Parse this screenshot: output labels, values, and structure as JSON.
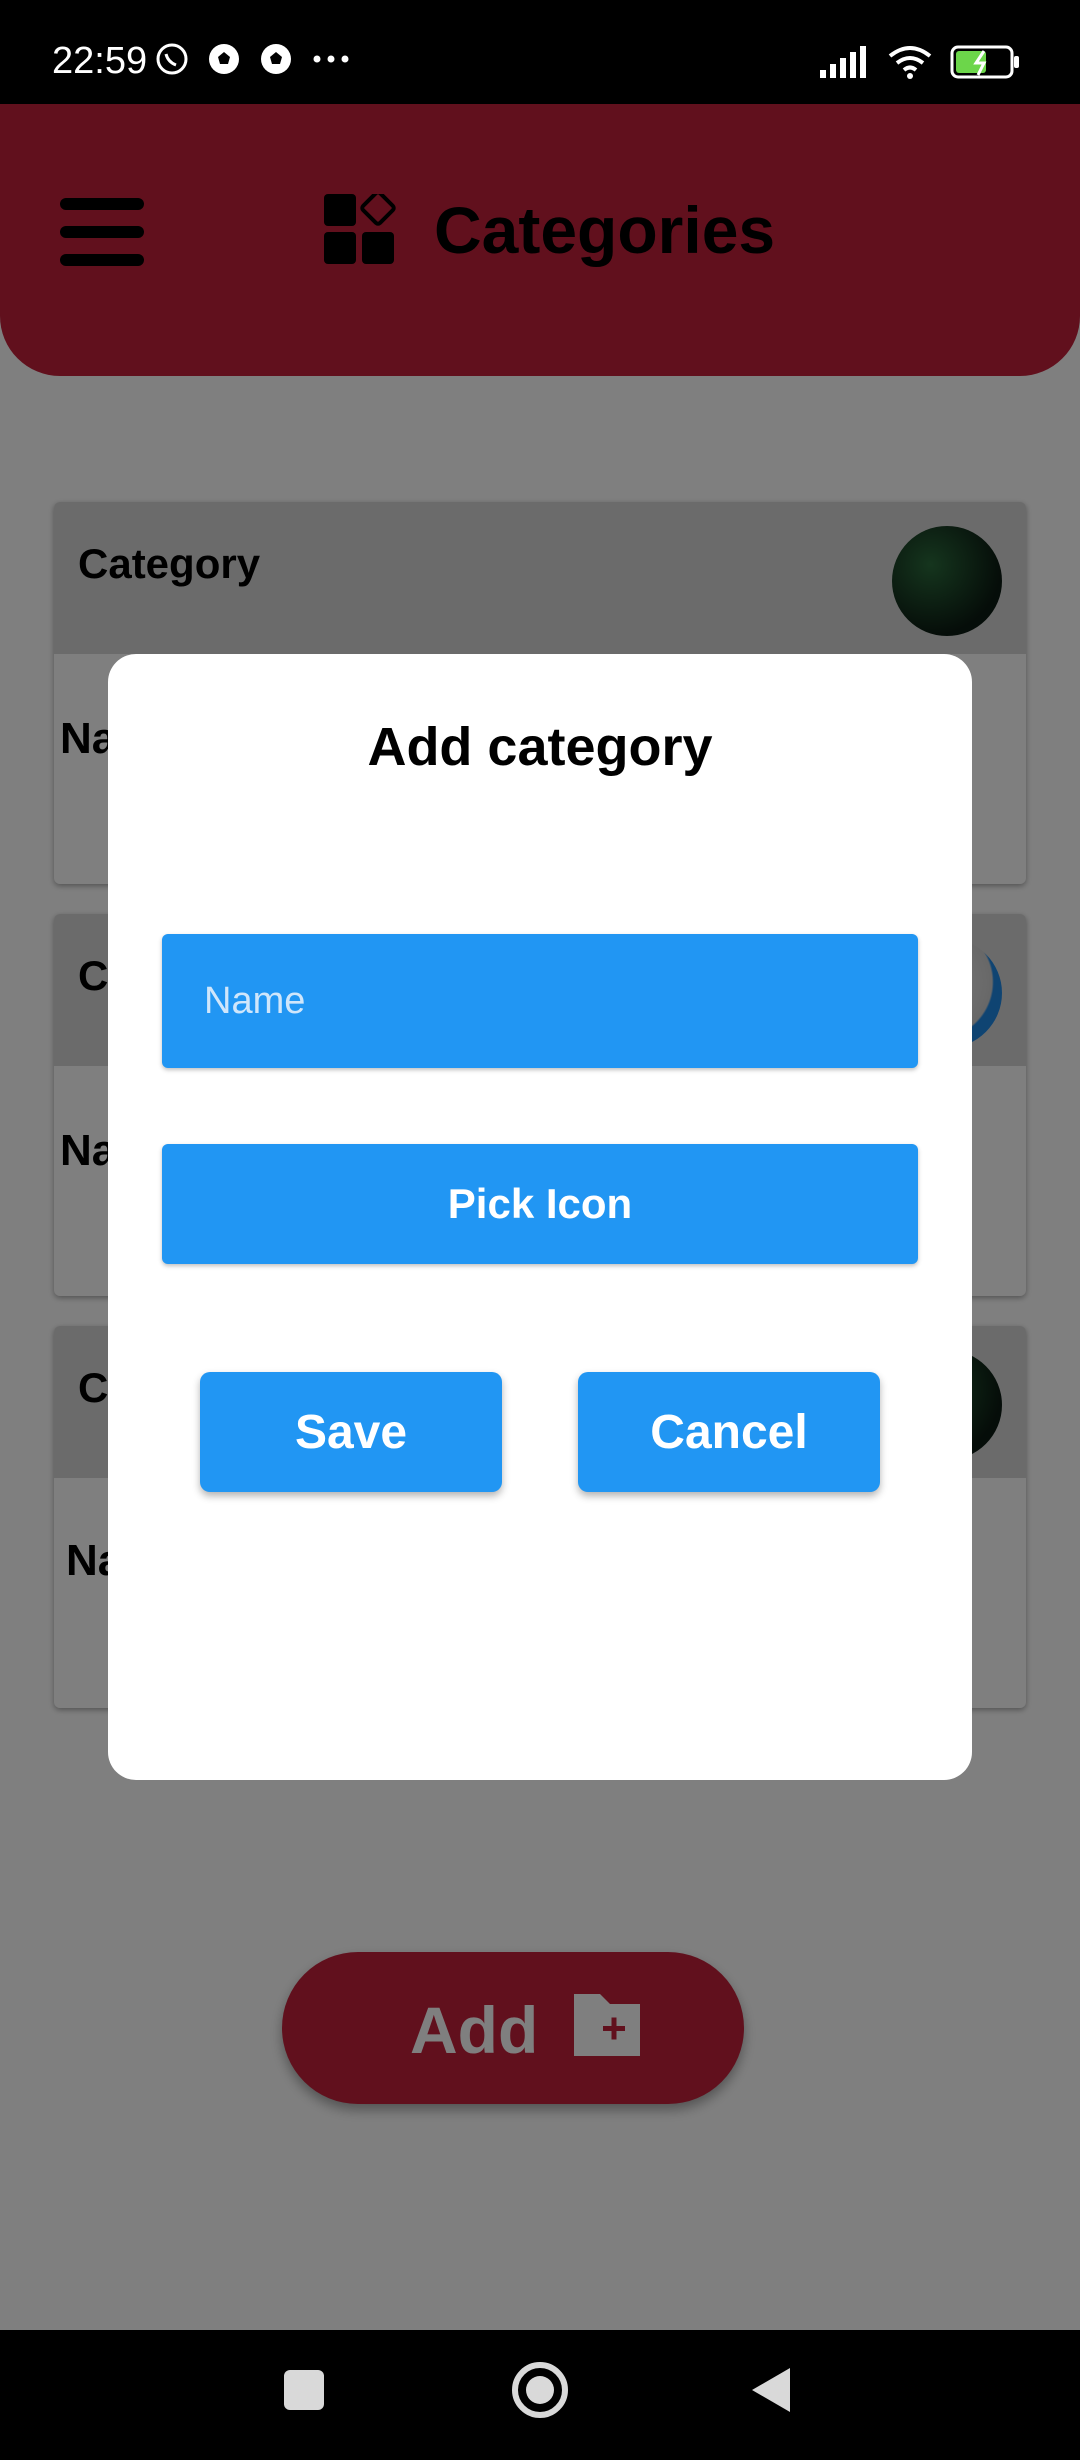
{
  "status_bar": {
    "time": "22:59",
    "notification_icons": [
      "whatsapp-icon",
      "soccer-ball-icon",
      "soccer-ball-icon",
      "more-dots-icon"
    ],
    "system_icons": [
      "signal-icon",
      "wifi-icon",
      "battery-charging-icon"
    ]
  },
  "app_bar": {
    "title": "Categories",
    "menu_icon": "hamburger-menu-icon",
    "title_icon": "category-icon",
    "background_color": "#c2203a"
  },
  "category_cards": [
    {
      "header_label": "Category",
      "body_label": "Na"
    },
    {
      "header_label": "C",
      "body_label": "Na"
    },
    {
      "header_label": "C",
      "body_label": "Na"
    }
  ],
  "add_button": {
    "label": "Add",
    "icon": "folder-add-icon"
  },
  "dialog": {
    "title": "Add category",
    "name_placeholder": "Name",
    "name_value": "",
    "pick_icon_label": "Pick Icon",
    "save_label": "Save",
    "cancel_label": "Cancel",
    "accent_color": "#2196f3"
  },
  "nav_bar": {
    "buttons": [
      "recent-apps-icon",
      "home-icon",
      "back-icon"
    ]
  }
}
